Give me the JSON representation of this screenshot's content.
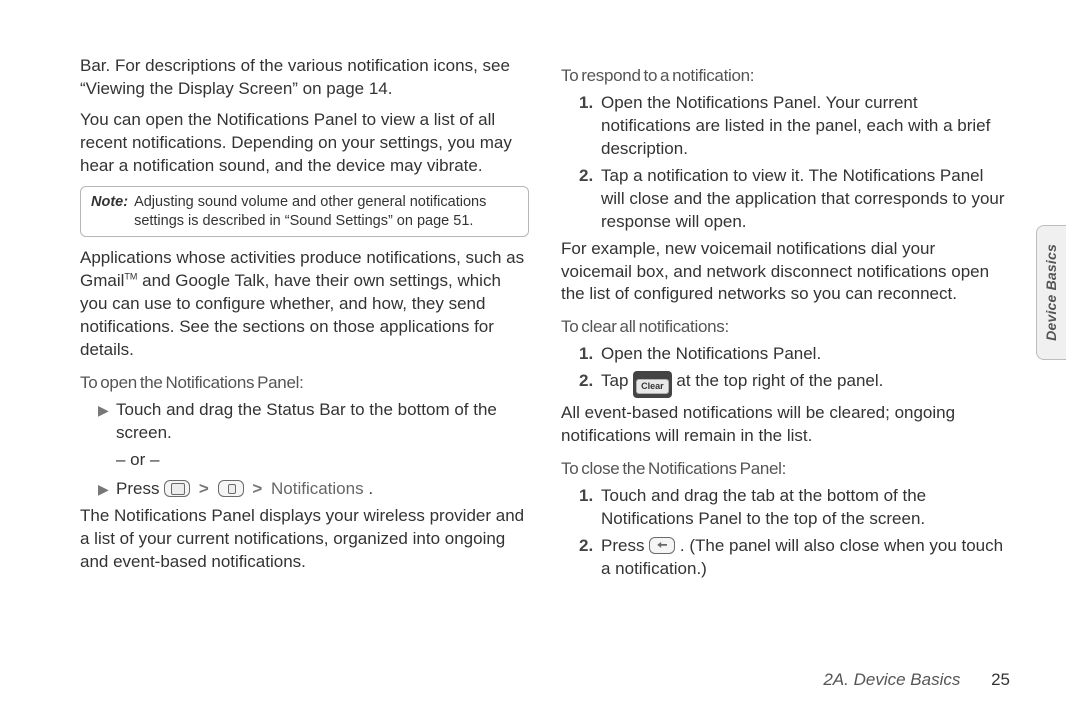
{
  "side_tab": "Device Basics",
  "footer": {
    "section": "2A. Device Basics",
    "page": "25"
  },
  "left": {
    "p1": "Bar. For descriptions of the various notification icons, see “Viewing the Display Screen” on page 14.",
    "p2": "You can open the Notifications Panel to view a list of all recent notifications. Depending on your settings, you may hear a notification sound, and the device may vibrate.",
    "note_label": "Note:",
    "note_text": "Adjusting sound volume and other general notifications settings is described in “Sound Settings” on page 51.",
    "p3_a": "Applications whose activities produce notifications, such as Gmail",
    "p3_tm": "TM",
    "p3_b": " and Google Talk, have their own settings, which you can use to configure whether, and how, they send notifications. See the sections on those applications for details.",
    "h1": "To open the Notifications Panel:",
    "b1": "Touch and drag the Status Bar to the bottom of the screen.",
    "or": "– or –",
    "b2_a": "Press ",
    "b2_b": "Notifications",
    "b2_c": ".",
    "p4": "The Notifications Panel displays your wireless provider and a list of your current notifications, organized into ongoing and event-based notifications."
  },
  "right": {
    "h1": "To respond to a notification:",
    "n1": "Open the Notifications Panel. Your current notifications are listed in the panel, each with a brief description.",
    "n2": "Tap a notification to view it. The Notifications Panel will close and the application that corresponds to your response will open.",
    "p1": "For example, new voicemail notifications dial your voicemail box, and network disconnect notifications open the list of configured networks so you can reconnect.",
    "h2": "To clear all notifications:",
    "c1": "Open the Notifications Panel.",
    "c2_a": "Tap ",
    "c2_clear": "Clear",
    "c2_b": " at the top right of the panel.",
    "p2": "All event-based notifications will be cleared; ongoing notifications will remain in the list.",
    "h3": "To close the Notifications Panel:",
    "d1": "Touch and drag the tab at the bottom of the Notifications Panel to the top of the screen.",
    "d2_a": "Press ",
    "d2_b": ". (The panel will also close when you touch a notification.)"
  }
}
